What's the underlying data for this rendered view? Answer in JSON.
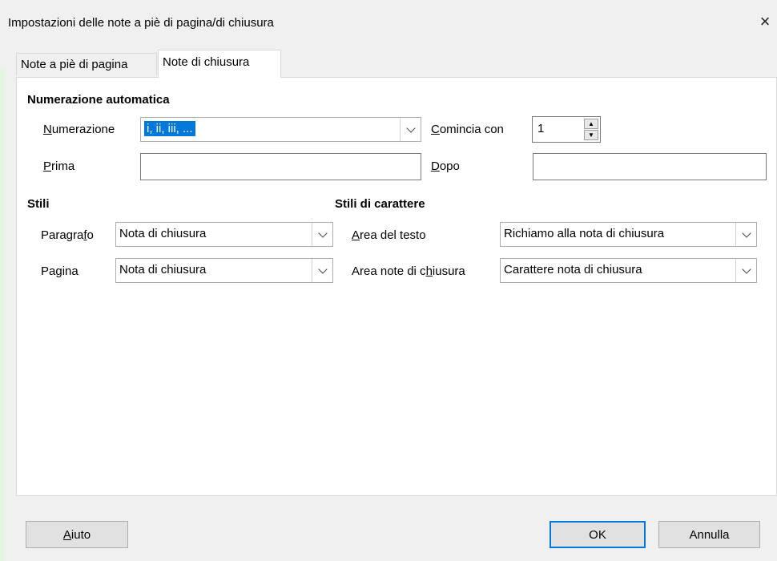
{
  "dialog": {
    "title": "Impostazioni delle note a piè di pagina/di chiusura",
    "close_glyph": "×"
  },
  "tabs": [
    {
      "label": "Note a piè di pagina",
      "active": false
    },
    {
      "label": "Note di chiusura",
      "active": true
    }
  ],
  "auto_numbering": {
    "heading": "Numerazione automatica",
    "numbering_label": "Numerazione",
    "numbering_value": "i, ii, iii, ...",
    "start_with_label": "Comincia con",
    "start_with_value": "1",
    "before_label": "Prima",
    "before_value": "",
    "after_label": "Dopo",
    "after_value": ""
  },
  "styles": {
    "heading": "Stili",
    "paragraph_label": "Paragrafo",
    "paragraph_value": "Nota di chiusura",
    "page_label": "Pagina",
    "page_value": "Nota di chiusura"
  },
  "char_styles": {
    "heading": "Stili di carattere",
    "text_area_label": "Area del testo",
    "text_area_value": "Richiamo alla nota di chiusura",
    "endnote_area_label": "Area note di chiusura",
    "endnote_area_value": "Carattere nota di chiusura"
  },
  "buttons": {
    "help": "Aiuto",
    "ok": "OK",
    "cancel": "Annulla"
  },
  "colors": {
    "accent": "#0078d7"
  }
}
